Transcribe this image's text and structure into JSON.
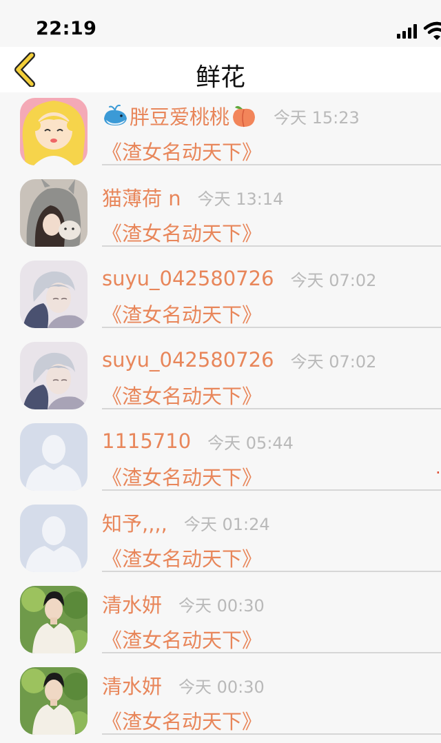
{
  "status": {
    "time": "22:19"
  },
  "nav": {
    "title": "鲜花",
    "back_icon": "chevron-left-icon"
  },
  "colors": {
    "accent": "#e8865a",
    "muted": "#b9b9b9",
    "back": "#f3cf3a"
  },
  "rows": [
    {
      "name": "胖豆爱桃桃",
      "time": "今天 15:23",
      "book": "《渣女名动天下》",
      "avatar": "anime-girl"
    },
    {
      "name": "猫薄荷 n",
      "time": "今天 13:14",
      "book": "《渣女名动天下》",
      "avatar": "girl-with-cat"
    },
    {
      "name": "suyu_042580726",
      "time": "今天 07:02",
      "book": "《渣女名动天下》",
      "avatar": "anime-couple"
    },
    {
      "name": "suyu_042580726",
      "time": "今天 07:02",
      "book": "《渣女名动天下》",
      "avatar": "anime-couple"
    },
    {
      "name": "1115710",
      "time": "今天 05:44",
      "book": "《渣女名动天下》",
      "avatar": "default-person"
    },
    {
      "name": "知予,,,,",
      "time": "今天 01:24",
      "book": "《渣女名动天下》",
      "avatar": "default-person"
    },
    {
      "name": "清水妍",
      "time": "今天 00:30",
      "book": "《渣女名动天下》",
      "avatar": "man-portrait"
    },
    {
      "name": "清水妍",
      "time": "今天 00:30",
      "book": "《渣女名动天下》",
      "avatar": "man-portrait"
    }
  ]
}
